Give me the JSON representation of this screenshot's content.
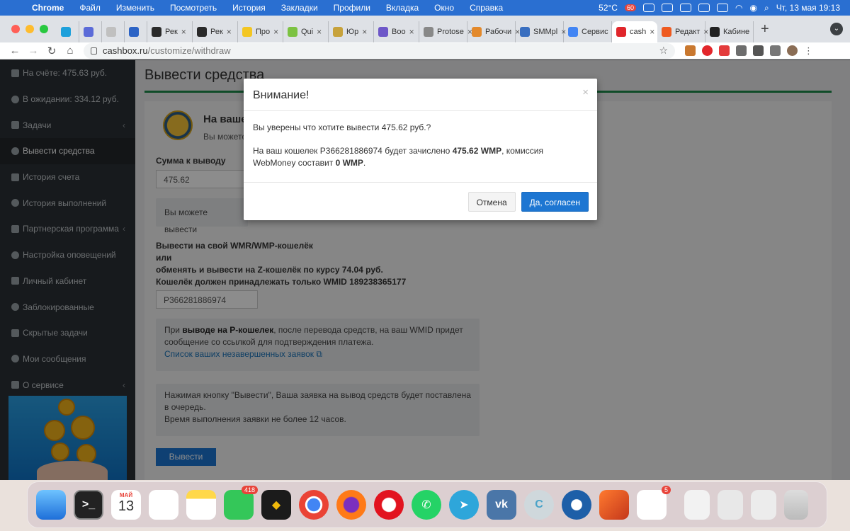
{
  "menubar": {
    "app": "Chrome",
    "items": [
      "Файл",
      "Изменить",
      "Посмотреть",
      "История",
      "Закладки",
      "Профили",
      "Вкладка",
      "Окно",
      "Справка"
    ],
    "temperature": "52°C",
    "badge": "60",
    "datetime": "Чт, 13 мая  19:13"
  },
  "tabs": [
    {
      "label": "",
      "color": "#1da0db"
    },
    {
      "label": "",
      "color": "#5b6bd8"
    },
    {
      "label": "",
      "color": "#c0c0c0"
    },
    {
      "label": "",
      "color": "#2c63c5"
    },
    {
      "label": "Рек",
      "color": "#2a2a2a"
    },
    {
      "label": "Рек",
      "color": "#2a2a2a"
    },
    {
      "label": "Про",
      "color": "#f3c623"
    },
    {
      "label": "Qui",
      "color": "#7cc242"
    },
    {
      "label": "Юр",
      "color": "#c7a23b"
    },
    {
      "label": "Boo",
      "color": "#6d57c8"
    },
    {
      "label": "Protose",
      "color": "#888888"
    },
    {
      "label": "Рабочи",
      "color": "#e3892b"
    },
    {
      "label": "SMMpl",
      "color": "#3a6fc0"
    },
    {
      "label": "Сервис",
      "color": "#4285f4"
    },
    {
      "label": "cash",
      "color": "#e0262b",
      "active": true
    },
    {
      "label": "Редакт",
      "color": "#ee5a1f"
    },
    {
      "label": "Кабине",
      "color": "#222222"
    }
  ],
  "address": {
    "url_host": "cashbox.ru",
    "url_path": "/customize/withdraw"
  },
  "sidebar": {
    "items": [
      {
        "label": "На счёте: 475.63 руб.",
        "arrow": ""
      },
      {
        "label": "В ожидании: 334.12 руб.",
        "arrow": ""
      },
      {
        "label": "Задачи",
        "arrow": "‹"
      },
      {
        "label": "Вывести средства",
        "arrow": "",
        "active": true
      },
      {
        "label": "История счета",
        "arrow": ""
      },
      {
        "label": "История выполнений",
        "arrow": ""
      },
      {
        "label": "Партнерская программа",
        "arrow": "‹"
      },
      {
        "label": "Настройка оповещений",
        "arrow": ""
      },
      {
        "label": "Личный кабинет",
        "arrow": ""
      },
      {
        "label": "Заблокированные",
        "arrow": ""
      },
      {
        "label": "Скрытые задачи",
        "arrow": ""
      },
      {
        "label": "Мои сообщения",
        "arrow": ""
      },
      {
        "label": "О сервисе",
        "arrow": "‹"
      }
    ]
  },
  "page": {
    "title": "Вывести средства",
    "wallet_title": "На ваше",
    "wallet_sub": "Вы можете",
    "amount_label": "Сумма к выводу",
    "amount_value": "475.62",
    "info1": "Вы можете вывести",
    "wmr_l1": "Вывести на свой WMR/WMP-кошелёк",
    "wmr_l2": "или",
    "wmr_l3": "обменять и вывести на Z-кошелёк по курсу 74.04 руб.",
    "wmr_l4": "Кошелёк должен принадлежать только WMID 189238365177",
    "wallet_value": "P366281886974",
    "info2_pre": "При ",
    "info2_bold": "выводе на P-кошелек",
    "info2_post": ", после перевода средств, на ваш WMID придет сообщение со ссылкой для подтверждения платежа.",
    "info2_link": "Список ваших незавершенных заявок",
    "info3_l1": "Нажимая кнопку \"Вывести\", Ваша заявка на вывод средств будет поставлена в очередь.",
    "info3_l2": "Время выполнения заявки не более 12 часов.",
    "withdraw_button": "Вывести"
  },
  "modal": {
    "title": "Внимание!",
    "close": "×",
    "line1": "Вы уверены что хотите вывести 475.62 руб.?",
    "line2_pre": "На ваш кошелек P366281886974 будет зачислено ",
    "line2_bold": "475.62 WMP",
    "line2_mid": ", комиссия WebMoney составит ",
    "line2_bold2": "0 WMP",
    "line2_end": ".",
    "cancel": "Отмена",
    "confirm": "Да, согласен"
  },
  "dock": {
    "calendar_month": "МАЙ",
    "calendar_day": "13",
    "messages_badge": "418",
    "appstore_badge": "5"
  }
}
